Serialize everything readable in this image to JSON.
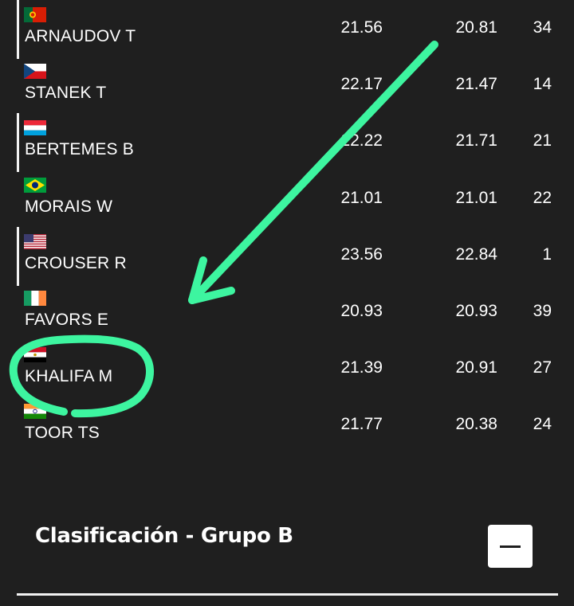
{
  "colors": {
    "background": "#1f1f1f",
    "text": "#ffffff",
    "annotation": "#3df5a0"
  },
  "results": {
    "rows": [
      {
        "name": "ARNAUDOV T",
        "flag": "portugal-flag",
        "best": "21.56",
        "season": "20.81",
        "rank": "34",
        "marker": true
      },
      {
        "name": "STANEK T",
        "flag": "czech-republic-flag",
        "best": "22.17",
        "season": "21.47",
        "rank": "14",
        "marker": false
      },
      {
        "name": "BERTEMES B",
        "flag": "luxembourg-flag",
        "best": "22.22",
        "season": "21.71",
        "rank": "21",
        "marker": true
      },
      {
        "name": "MORAIS W",
        "flag": "brazil-flag",
        "best": "21.01",
        "season": "21.01",
        "rank": "22",
        "marker": false
      },
      {
        "name": "CROUSER R",
        "flag": "usa-flag",
        "best": "23.56",
        "season": "22.84",
        "rank": "1",
        "marker": true
      },
      {
        "name": "FAVORS E",
        "flag": "ireland-flag",
        "best": "20.93",
        "season": "20.93",
        "rank": "39",
        "marker": false
      },
      {
        "name": "KHALIFA M",
        "flag": "egypt-flag",
        "best": "21.39",
        "season": "20.91",
        "rank": "27",
        "marker": false
      },
      {
        "name": "TOOR TS",
        "flag": "india-flag",
        "best": "21.77",
        "season": "20.38",
        "rank": "24",
        "marker": false
      }
    ]
  },
  "section": {
    "title": "Clasificación - Grupo B",
    "toggle_icon": "minus-icon"
  },
  "annotation": {
    "arrow": "arrow-down-left-icon",
    "highlight": "circle-around-khalifa"
  }
}
